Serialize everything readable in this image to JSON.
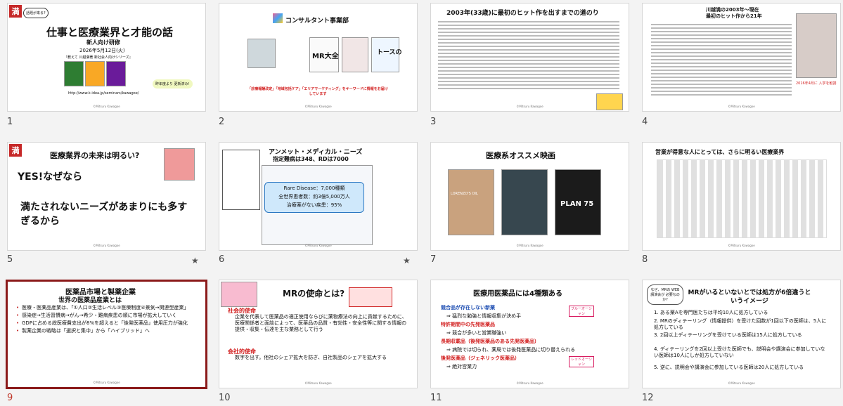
{
  "slides": [
    {
      "num": "1",
      "title": "仕事と医療業界と才能の話",
      "sub": "新人向け研修",
      "date": "2026年5月12日(火)",
      "series": "『教えて 川越満著 新社会人向けシリーズ』",
      "bubble": "話題が来る?",
      "url": "http://www.k-idea.jp/seminars/kawagoe/",
      "badge": "満",
      "note": "昨年度より 更新済み!"
    },
    {
      "num": "2",
      "company": "コンサルタント事業部",
      "caption": "「診療報酬改定」「地域包括ケア」「エリアマーケティング」をキーワードに情報をお届けしています",
      "books": [
        "MR大全",
        "トースの"
      ]
    },
    {
      "num": "3",
      "title": "2003年(33歳)に最初のヒット作を出すまでの道のり"
    },
    {
      "num": "4",
      "title": "川越満の2003年～現在",
      "sub": "最初のヒット作から21年",
      "note": "2016年4月に 入学を勧誘"
    },
    {
      "num": "5",
      "title": "医療業界の未来は明るい?",
      "line1": "YES!なぜなら",
      "line2": "満たされないニーズがあまりにも多すぎるから",
      "badge": "満",
      "star": "★"
    },
    {
      "num": "6",
      "title": "アンメット・メディカル・ニーズ",
      "sub": "指定難病は348、RDは7000",
      "box1": "Rare Disease：7,000種類",
      "box2": "全世界患者数：約3億5,000万人",
      "box3": "治療薬がない疾患：95%",
      "star": "★"
    },
    {
      "num": "7",
      "title": "医療系オススメ映画",
      "movies": [
        "LORENZO'S OIL",
        "",
        "PLAN 75"
      ]
    },
    {
      "num": "8",
      "title": "営業が得意な人にとっては、さらに明るい医療業界"
    },
    {
      "num": "9",
      "title": "医薬品市場と製薬企業",
      "sub": "世界の医薬品産業とは",
      "bullets": [
        "医療・医薬品産業は、「①人口②生活レベル③医療制度④景気→関連型産業」",
        "感染症→生活習慣病→がん→希少・難病疾患の順に市場が拡大していく",
        "GDPに占める総医療費支出が8%を超えると「後発医薬品」使用圧力が強化",
        "製薬企業の戦略は「選択と集中」から「ハイブリッド」へ"
      ]
    },
    {
      "num": "10",
      "title": "MRの使命とは?",
      "h1": "社会的使命",
      "p1": "企業を代表して医薬品の適正使用ならびに薬物療法の向上に貢献するために、医療関係者と面談によって、医薬品の品質・有効性・安全性等に関する情報の提供・収集・伝達を主な業務として行う",
      "h2": "会社的使命",
      "p2": "数字を出す。他社のシェア拡大を防ぎ、自社製品のシェアを拡大する"
    },
    {
      "num": "11",
      "title": "医療用医薬品には4種類ある",
      "items": [
        "競合品が存在しない新薬",
        "⇒ 猛烈な勉強と情報収集が決め手",
        "特許期間中の先発医薬品",
        "⇒ 競合が多いと営業職強い",
        "長期収載品（後発医薬品のある先発医薬品）",
        "⇒ 病院では切られ、薬局では後発医薬品に切り替えられる",
        "後発医薬品（ジェネリック医薬品）",
        "⇒ 絶対営業力"
      ],
      "tag1": "ブルーオーシャン",
      "tag2": "レッドオーシャン"
    },
    {
      "num": "12",
      "title": "MRがいるといないとでは処方が6倍違うというイメージ",
      "items": [
        "1. ある薬Aを専門医たちは平均10人に処方している",
        "2. MRのディテーリング（情報提供）を受けた回数が1回以下の医師は、5人に処方している",
        "3. 2回以上ディテーリングを受けている医師は15人に処方している",
        "4. ディテーリングを2回以上受けた医師でも、説明会や講演会に参加していない医師は10人にしか処方していない",
        "5. 逆に、説明会や講演会に参加している医師は20人に処方している"
      ],
      "bubble": "なぜ、MRの WEB講演会が 必要なのか?"
    }
  ],
  "footer": "©Mitsuru Kawagoe",
  "colors": {
    "accent": "#c62828",
    "selected": "#8b1a1a",
    "blue": "#1f4fb3"
  }
}
